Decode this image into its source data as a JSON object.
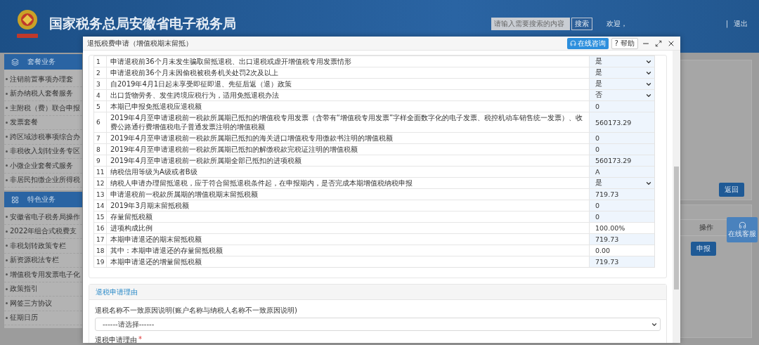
{
  "header": {
    "title": "国家税务总局安徽省电子税务局",
    "search": {
      "placeholder": "请输入需要搜索的内容",
      "button": "搜索"
    },
    "welcome": "欢迎，",
    "separator": "|",
    "logout": "退出"
  },
  "sidebar": {
    "sections": [
      {
        "title": "套餐业务",
        "items": [
          "注销前置事项办理套",
          "新办纳税人套餐服务",
          "主附税（费）联合申报",
          "发票套餐",
          "跨区域涉税事项综合办",
          "非税收入划转业务专区",
          "小微企业套餐式服务",
          "非居民扣缴企业所得税"
        ]
      },
      {
        "title": "特色业务",
        "items": [
          "安徽省电子税务局操作",
          "2022年组合式税费支",
          "非税划转政策专栏",
          "新资源税法专栏",
          "增值税专用发票电子化",
          "政策指引",
          "网签三方协议",
          "征期日历"
        ]
      }
    ]
  },
  "content": {
    "back_button": "返回",
    "column_header": "操作",
    "action_button": "申报"
  },
  "float_service": {
    "label": "在线客服"
  },
  "dialog": {
    "title": "退抵税费申请（增值税期末留抵）",
    "consult_button": "在线咨询",
    "help_button": "? 帮助",
    "rows": [
      {
        "no": "1",
        "item": "申请退税前36个月未发生骗取留抵退税、出口退税或虚开增值税专用发票情形",
        "value": "是",
        "kind": "select",
        "shaded": true
      },
      {
        "no": "2",
        "item": "申请退税前36个月未因偷税被税务机关处罚2次及以上",
        "value": "是",
        "kind": "select",
        "shaded": true
      },
      {
        "no": "3",
        "item": "自2019年4月1日起未享受即征即退、先征后返（退）政策",
        "value": "是",
        "kind": "select",
        "shaded": true
      },
      {
        "no": "4",
        "item": "出口货物劳务、发生跨境应税行为，适用免抵退税办法",
        "value": "否",
        "kind": "select",
        "shaded": true
      },
      {
        "no": "5",
        "item": "本期已申报免抵退税应退税额",
        "value": "0",
        "kind": "text",
        "shaded": true
      },
      {
        "no": "6",
        "item": "2019年4月至申请退税前一税款所属期已抵扣的增值税专用发票（含带有“增值税专用发票”字样全面数字化的电子发票、税控机动车销售统一发票）、收费公路通行费增值税电子普通发票注明的增值税额",
        "value": "560173.29",
        "kind": "text",
        "shaded": true
      },
      {
        "no": "7",
        "item": "2019年4月至申请退税前一税款所属期已抵扣的海关进口增值税专用缴款书注明的增值税额",
        "value": "0",
        "kind": "text",
        "shaded": true
      },
      {
        "no": "8",
        "item": "2019年4月至申请退税前一税款所属期已抵扣的解缴税款完税证注明的增值税额",
        "value": "0",
        "kind": "text",
        "shaded": true
      },
      {
        "no": "9",
        "item": "2019年4月至申请退税前一税款所属期全部已抵扣的进项税额",
        "value": "560173.29",
        "kind": "text",
        "shaded": true
      },
      {
        "no": "11",
        "item": "纳税信用等级为A级或者B级",
        "value": "A",
        "kind": "text",
        "shaded": true
      },
      {
        "no": "12",
        "item": "纳税人申请办理留抵退税，应于符合留抵退税条件起，在申报期内，是否完成本期增值税纳税申报",
        "value": "是",
        "kind": "select",
        "shaded": true
      },
      {
        "no": "13",
        "item": "申请退税前一税款所属期的增值税期末留抵税额",
        "value": "719.73",
        "kind": "text",
        "shaded": true
      },
      {
        "no": "14",
        "item": "2019年3月期末留抵税额",
        "value": "0",
        "kind": "text",
        "shaded": true
      },
      {
        "no": "15",
        "item": "存量留抵税额",
        "value": "0",
        "kind": "text",
        "shaded": true
      },
      {
        "no": "16",
        "item": "进项构成比例",
        "value": "100.00%",
        "kind": "text",
        "shaded": false
      },
      {
        "no": "17",
        "item": "本期申请退还的期末留抵税额",
        "value": "719.73",
        "kind": "text",
        "shaded": true
      },
      {
        "no": "18",
        "item": "其中：本期申请退还的存量留抵税额",
        "value": "0.00",
        "kind": "text",
        "shaded": false
      },
      {
        "no": "19",
        "item": "本期申请退还的增量留抵税额",
        "value": "719.73",
        "kind": "text",
        "shaded": true
      }
    ],
    "reason_section": {
      "title": "退税申请理由",
      "mismatch_label": "退税名称不一致原因说明(账户名称与纳税人名称不一致原因说明)",
      "mismatch_select": "------请选择------",
      "reason_label": "退税申请理由",
      "required_mark": "*"
    }
  }
}
